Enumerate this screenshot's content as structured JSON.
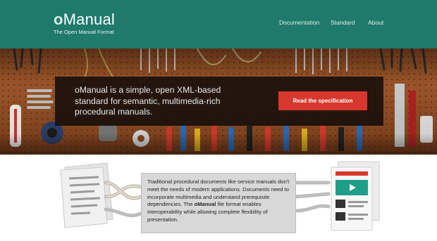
{
  "header": {
    "logo_o": "o",
    "logo_rest": "Manual",
    "tagline": "The Open Manual Format",
    "nav": [
      "Documentation",
      "Standard",
      "About"
    ]
  },
  "hero": {
    "text": "oManual is a simple, open XML-based standard for semantic, multimedia-rich procedural manuals.",
    "button_label": "Read the specification"
  },
  "description": {
    "part1": "Traditional procedural documents like service manuals don't meet the needs of modern applications. Documents need to incorporate multimedia and understand prerequisite dependencies. The ",
    "bold": "oManual",
    "part2": " file format enables interoperability while allowing complete flexibility of presentation."
  },
  "colors": {
    "header_bg": "#1f7a6c",
    "cta": "#d7372d",
    "accent_teal": "#1f9e88"
  }
}
